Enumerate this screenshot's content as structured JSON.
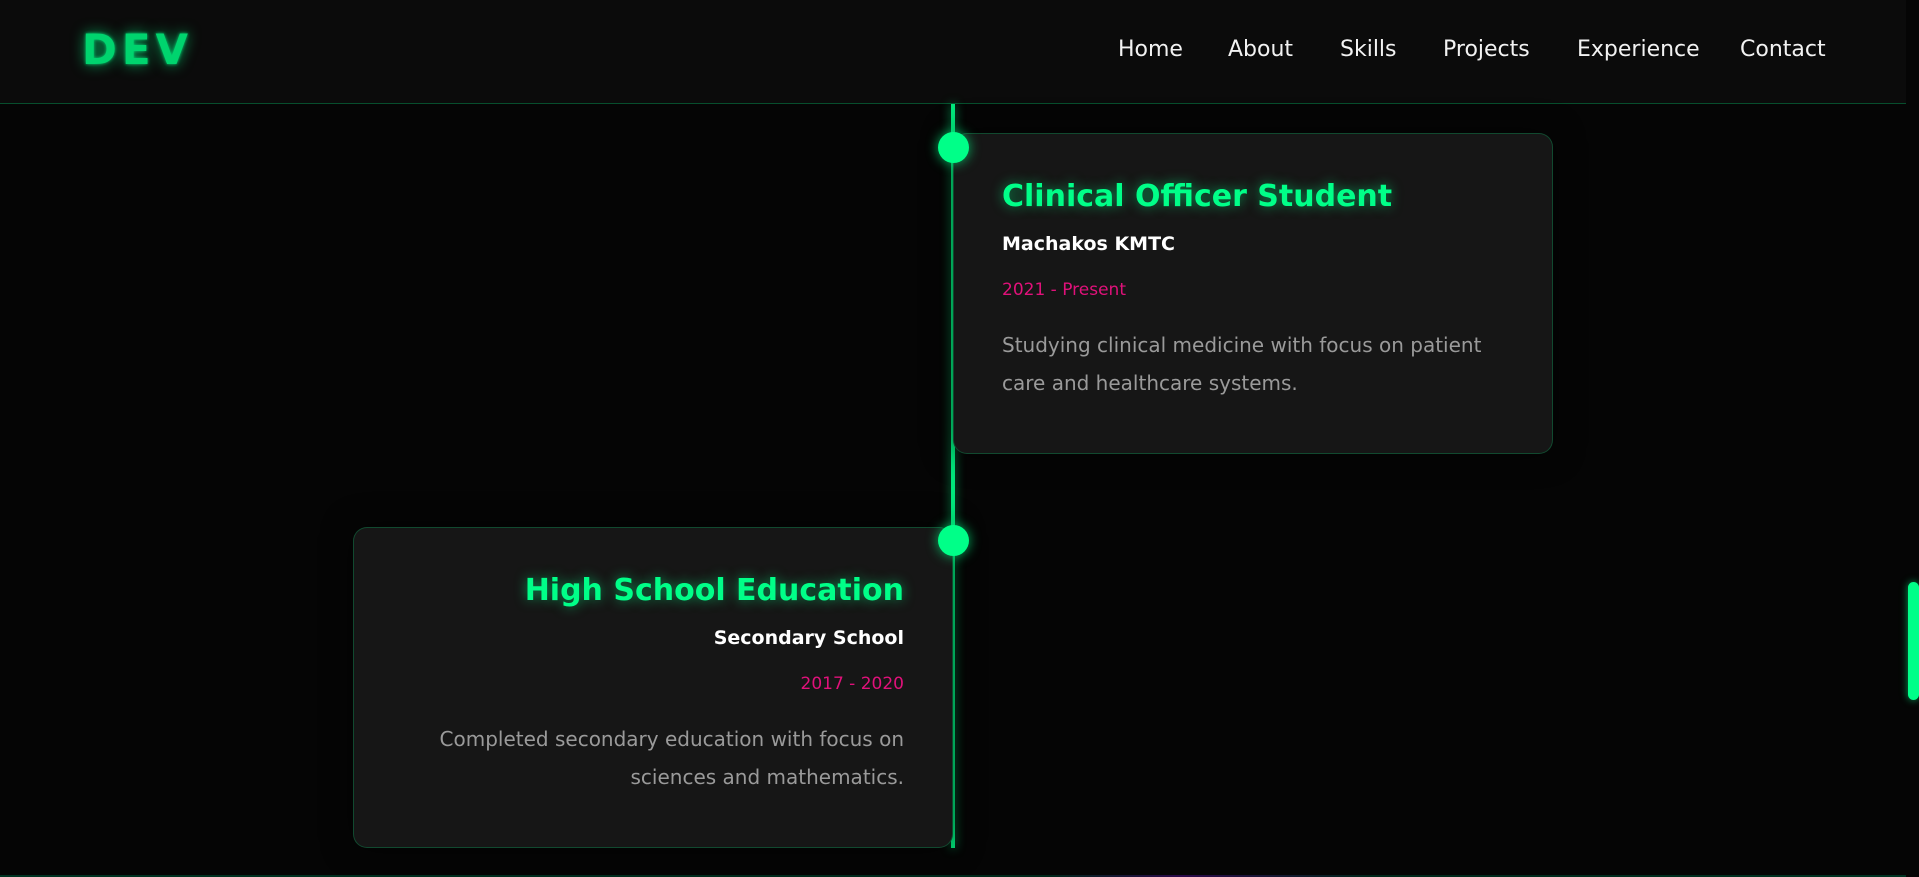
{
  "header": {
    "logo": "DEV",
    "nav": {
      "home": "Home",
      "about": "About",
      "skills": "Skills",
      "projects": "Projects",
      "experience": "Experience",
      "contact": "Contact"
    }
  },
  "timeline": {
    "items": [
      {
        "title": "Clinical Officer Student",
        "organization": "Machakos KMTC",
        "date": "2021 - Present",
        "description": "Studying clinical medicine with focus on patient care and healthcare systems."
      },
      {
        "title": "High School Education",
        "organization": "Secondary School",
        "date": "2017 - 2020",
        "description": "Completed secondary education with focus on sciences and mathematics."
      }
    ]
  },
  "colors": {
    "accent": "#00ff88",
    "date": "#e0117a",
    "background": "#050505",
    "card": "#161616"
  }
}
